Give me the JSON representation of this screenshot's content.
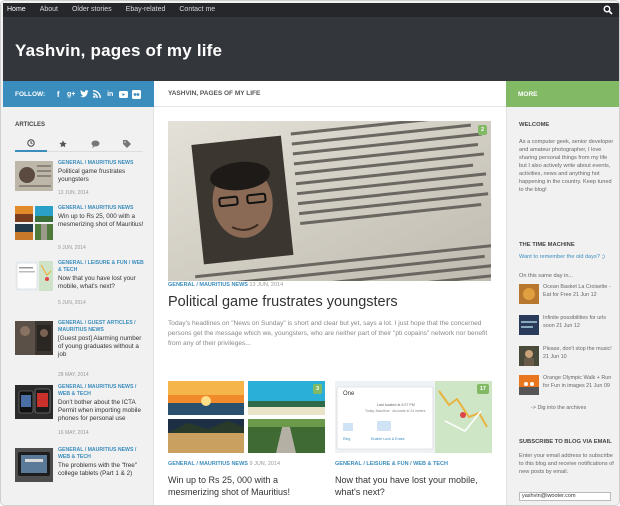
{
  "nav": {
    "items": [
      "Home",
      "About",
      "Older stories",
      "Ebay-related",
      "Contact me"
    ]
  },
  "site": {
    "title": "Yashvin, pages of my life"
  },
  "follow": {
    "label": "FOLLOW:"
  },
  "breadcrumb": "YASHVIN, PAGES OF MY LIFE",
  "more": "MORE",
  "left": {
    "title": "ARTICLES",
    "tab_icons": [
      "clock-icon",
      "star-icon",
      "comment-icon",
      "tag-icon"
    ],
    "articles": [
      {
        "cat": "GENERAL / MAURITIUS NEWS",
        "title": "Political game frustrates youngsters",
        "date": "13 JUN, 2014"
      },
      {
        "cat": "GENERAL / MAURITIUS NEWS",
        "title": "Win up to Rs 25, 000 with a mesmerizing shot of Mauritius!",
        "date": "9 JUN, 2014"
      },
      {
        "cat": "GENERAL / LEISURE & FUN / WEB & TECH",
        "title": "Now that you have lost your mobile, what's next?",
        "date": "5 JUN, 2014"
      },
      {
        "cat": "GENERAL / GUEST ARTICLES / MAURITIUS NEWS",
        "title": "[Guest post] Alarming number of young graduates without a job",
        "date": "28 MAY, 2014"
      },
      {
        "cat": "GENERAL / MAURITIUS NEWS / WEB & TECH",
        "title": "Don't bother about the ICTA Permit when importing mobile phones for personal use",
        "date": "16 MAY, 2014"
      },
      {
        "cat": "GENERAL / MAURITIUS NEWS / WEB & TECH",
        "title": "The problems with the \"free\" college tablets (Part 1 & 2)",
        "date": ""
      }
    ]
  },
  "main": {
    "featured": {
      "comments": "2",
      "cat": "GENERAL / MAURITIUS NEWS",
      "date": "13 JUN, 2014",
      "title": "Political game frustrates youngsters",
      "excerpt": "Today's headlines on \"News on Sunday\" is short and clear but yet, says a lot. I just hope that the concerned persons get the message which we, youngsters, who are neither part of their \"pti copains\" network nor benefit from any of their privileges..."
    },
    "cards": [
      {
        "comments": "3",
        "cat": "GENERAL / MAURITIUS NEWS",
        "date": "9 JUN, 2014",
        "title": "Win up to Rs 25, 000 with a mesmerizing shot of Mauritius!"
      },
      {
        "comments": "17",
        "cat": "GENERAL / LEISURE & FUN / WEB & TECH",
        "date": "",
        "title": "Now that you have lost your mobile, what's next?",
        "phone": {
          "name": "One",
          "line1": "Last located at 9:27 PM",
          "line2": "Today, Mauritius · Accurate to 24 meters",
          "a1": "Ring",
          "a2": "Enable Lock & Erase"
        }
      }
    ]
  },
  "right": {
    "welcome_title": "WELCOME",
    "welcome_text": "As a computer geek, senior developer and amateur photographer, I love sharing personal things from my life but I also actively write about events, activities, news and anything hot happening in the country. Keep tuned to the blog!",
    "tm_title": "THE TIME MACHINE",
    "tm_question": "Want to remember the old days? ;)",
    "tm_on": "On this same day in...",
    "tm_items": [
      {
        "date": "",
        "text": "Ocean Basket La Croisette - Eat for Free",
        "year": "21 Jun 12"
      },
      {
        "date": "",
        "text": "Infinite possibilities for urls soon",
        "year": "21 Jun 12"
      },
      {
        "date": "",
        "text": "Please, don't stop the music!",
        "year": "21 Jun 10"
      },
      {
        "date": "",
        "text": "Orange Olympic Walk + Run for Fun in images",
        "year": "21 Jun 09"
      }
    ],
    "tm_dig": "-> Dig into the archives",
    "sub_title": "SUBSCRIBE TO BLOG VIA EMAIL",
    "sub_text": "Enter your email address to subscribe to this blog and receive notifications of new posts by email.",
    "sub_value": "yashvin@iwooter.com"
  },
  "colors": {
    "accent": "#3b8dbd",
    "green": "#82b965",
    "dark": "#33363b"
  }
}
